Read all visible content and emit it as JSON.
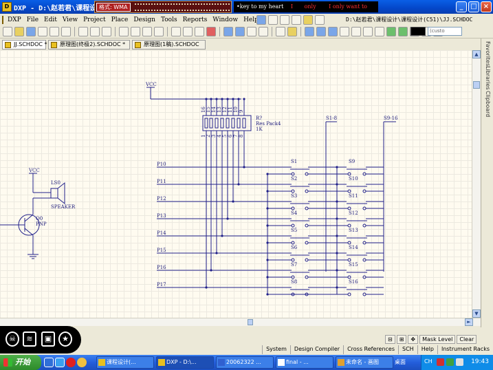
{
  "window": {
    "title": "DXP - D:\\赵若君\\课程设",
    "app_icon": "dxp-app-icon"
  },
  "music": {
    "format_label": "格式: WMA",
    "lyric_white_1": "•key to my heart",
    "lyric_red_1": "I",
    "lyric_red_2": "only",
    "lyric_red_3": "I only want to"
  },
  "menu": {
    "items": [
      "DXP",
      "File",
      "Edit",
      "View",
      "Project",
      "Place",
      "Design",
      "Tools",
      "Reports",
      "Window",
      "Help"
    ]
  },
  "path_bar": {
    "path": "D:\\赵若君\\课程设计\\课程设计(C51)\\JJ.SCHDOC"
  },
  "toolbar": {
    "custom_select": "(custo"
  },
  "doc_tabs": [
    {
      "label": "JJ.SCHDOC *"
    },
    {
      "label": "原理图(终极2).SCHDOC *"
    },
    {
      "label": "原理图(1稿).SCHDOC"
    }
  ],
  "side_panels": [
    "Favorites",
    "Libraries",
    "Clipboard"
  ],
  "schematic": {
    "vcc_top": "VCC",
    "vcc_left": "VCC",
    "respack": {
      "ref": "R?",
      "name": "Res Pack4",
      "value": "1K",
      "pins_top": [
        "16",
        "15",
        "14",
        "13",
        "12",
        "11",
        "10",
        "9"
      ],
      "pins_bottom": [
        "1",
        "2",
        "3",
        "4",
        "5",
        "6",
        "7",
        "8"
      ]
    },
    "bus_left": "S1-8",
    "bus_right": "S9-16",
    "ports": [
      "P10",
      "P11",
      "P12",
      "P13",
      "P14",
      "P15",
      "P16",
      "P17"
    ],
    "switches_left": [
      "S1",
      "S2",
      "S3",
      "S4",
      "S5",
      "S6",
      "S7",
      "S8"
    ],
    "switches_right": [
      "S9",
      "S10",
      "S11",
      "S12",
      "S13",
      "S14",
      "S15",
      "S16"
    ],
    "speaker_ref": "LS0",
    "speaker_name": "SPEAKER",
    "transistor_ref": "Q0",
    "transistor_type": "PNP"
  },
  "bottom_controls": {
    "mask_level": "Mask Level",
    "clear": "Clear"
  },
  "panel_buttons": [
    "System",
    "Design Compiler",
    "Cross References",
    "SCH",
    "Help",
    "Instrument Racks"
  ],
  "taskbar": {
    "start": "开始",
    "tasks": [
      {
        "label": "课程设计(..."
      },
      {
        "label": "DXP - D:\\..."
      },
      {
        "label": "20062322 ..."
      },
      {
        "label": "final - ..."
      },
      {
        "label": "未命名 - 画图"
      }
    ],
    "desktop": "桌面",
    "lang": "CH",
    "clock": "19:43"
  }
}
